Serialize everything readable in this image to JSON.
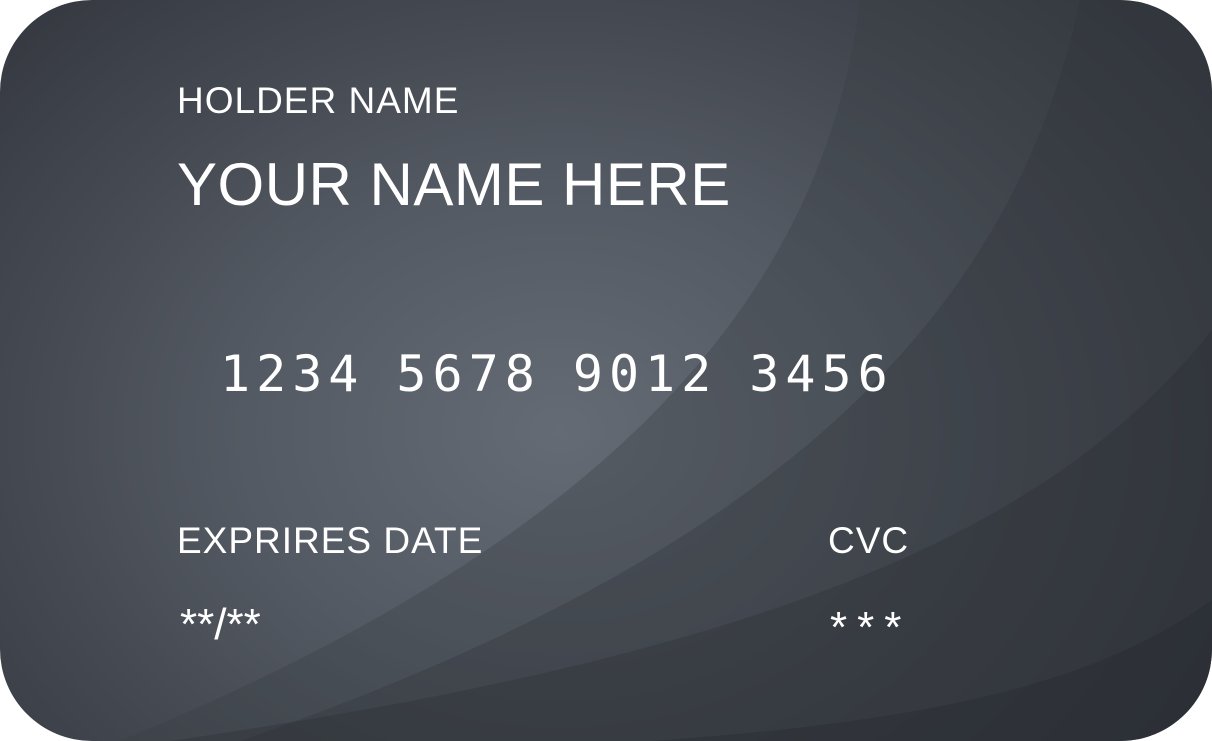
{
  "card": {
    "holder_label": "HOLDER NAME",
    "holder_name": "YOUR NAME HERE",
    "number_groups": [
      "1234",
      "5678",
      "9012",
      "3456"
    ],
    "expiry_label": "EXPRIRES DATE",
    "expiry_value": "**/**",
    "cvc_label": "CVC",
    "cvc_value": "***"
  },
  "colors": {
    "text": "#ffffff",
    "card_base": "#4a4f57",
    "card_dark": "#2b2e35"
  }
}
